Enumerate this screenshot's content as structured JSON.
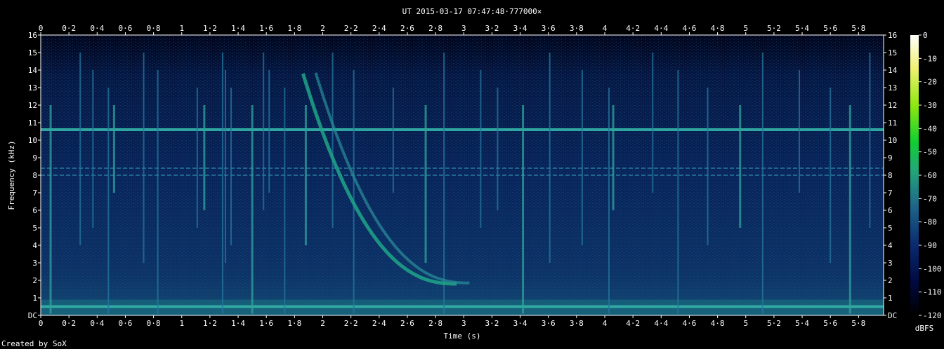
{
  "chart_data": {
    "type": "heatmap",
    "title": "UT 2015-03-17 07:47:48·777000×",
    "xlabel": "Time (s)",
    "ylabel": "Frequency (kHz)",
    "xlim": [
      0,
      5.96
    ],
    "ylim": [
      0,
      16
    ],
    "x_ticks": [
      "0",
      "0·2",
      "0·4",
      "0·6",
      "0·8",
      "1",
      "1·2",
      "1·4",
      "1·6",
      "1·8",
      "2",
      "2·2",
      "2·4",
      "2·6",
      "2·8",
      "3",
      "3·2",
      "3·4",
      "3·6",
      "3·8",
      "4",
      "4·2",
      "4·4",
      "4·6",
      "4·8",
      "5",
      "5·2",
      "5·4",
      "5·6",
      "5·8"
    ],
    "y_ticks": [
      "DC",
      "1",
      "2",
      "3",
      "4",
      "5",
      "6",
      "7",
      "8",
      "9",
      "10",
      "11",
      "12",
      "13",
      "14",
      "15",
      "16"
    ],
    "colorbar": {
      "label": "dBFS",
      "ticks": [
        "0",
        "-10",
        "-20",
        "-30",
        "-40",
        "-50",
        "-60",
        "-70",
        "-80",
        "-90",
        "-100",
        "-110",
        "-120"
      ],
      "range": [
        -120,
        0
      ],
      "colors": [
        "#000000",
        "#000a40",
        "#0a2a70",
        "#1f6a8a",
        "#22a878",
        "#10d030",
        "#8ee810",
        "#f0f070",
        "#ffffff"
      ]
    },
    "features": {
      "horizontal_lines_khz": [
        10.6,
        8.4,
        8.0,
        0.5
      ],
      "impulses_s": [
        0.07,
        0.28,
        0.37,
        0.48,
        0.52,
        0.73,
        0.83,
        1.11,
        1.16,
        1.29,
        1.31,
        1.35,
        1.5,
        1.58,
        1.62,
        1.73,
        1.88,
        2.07,
        2.22,
        2.5,
        2.73,
        2.86,
        3.12,
        3.24,
        3.42,
        3.61,
        3.84,
        4.03,
        4.06,
        4.34,
        4.52,
        4.73,
        4.96,
        5.12,
        5.38,
        5.6,
        5.74,
        5.88
      ],
      "whistler": {
        "start_s": 1.86,
        "end_s": 2.95,
        "start_khz": 13.8,
        "end_khz": 1.8
      }
    }
  },
  "footer": {
    "credit": "Created by SoX"
  }
}
